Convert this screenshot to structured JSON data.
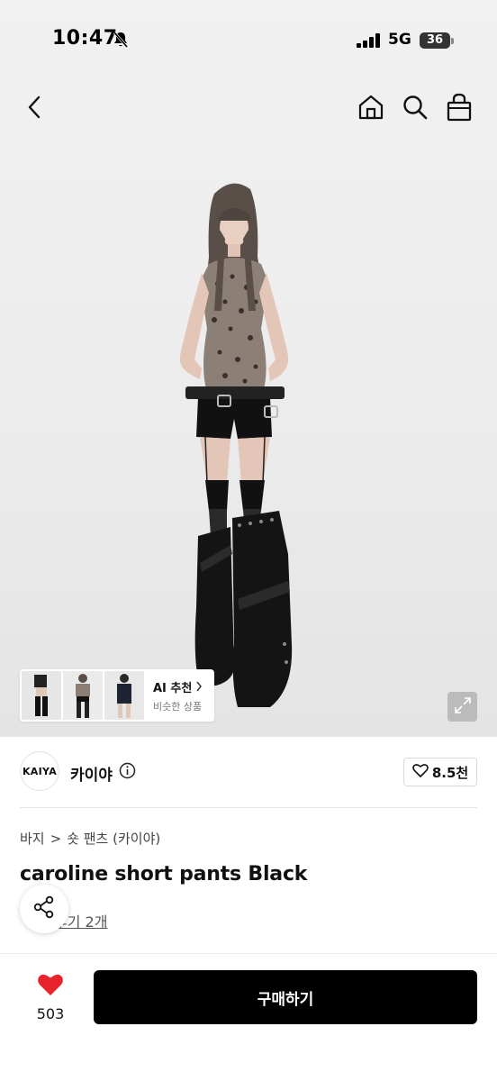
{
  "status": {
    "time": "10:47",
    "network": "5G",
    "battery": "36"
  },
  "ai_card": {
    "title": "AI 추천",
    "subtitle": "비슷한 상품"
  },
  "brand": {
    "logo_text": "KAIYA",
    "name": "카이야",
    "likes": "8.5천"
  },
  "breadcrumb": {
    "category": "바지",
    "separator": ">",
    "subcategory": "숏 팬츠 (카이야)"
  },
  "product": {
    "title": "caroline short pants Black",
    "reviews": "후기 2개"
  },
  "bottom": {
    "heart_count": "503",
    "buy_label": "구매하기"
  },
  "colors": {
    "accent": "#e8232c",
    "buy_button": "#000000"
  },
  "icons": [
    "bell-slash-icon",
    "signal-icon",
    "back-icon",
    "home-icon",
    "search-icon",
    "bag-icon",
    "chevron-right-icon",
    "expand-icon",
    "info-icon",
    "heart-outline-icon",
    "share-icon",
    "heart-filled-icon"
  ]
}
